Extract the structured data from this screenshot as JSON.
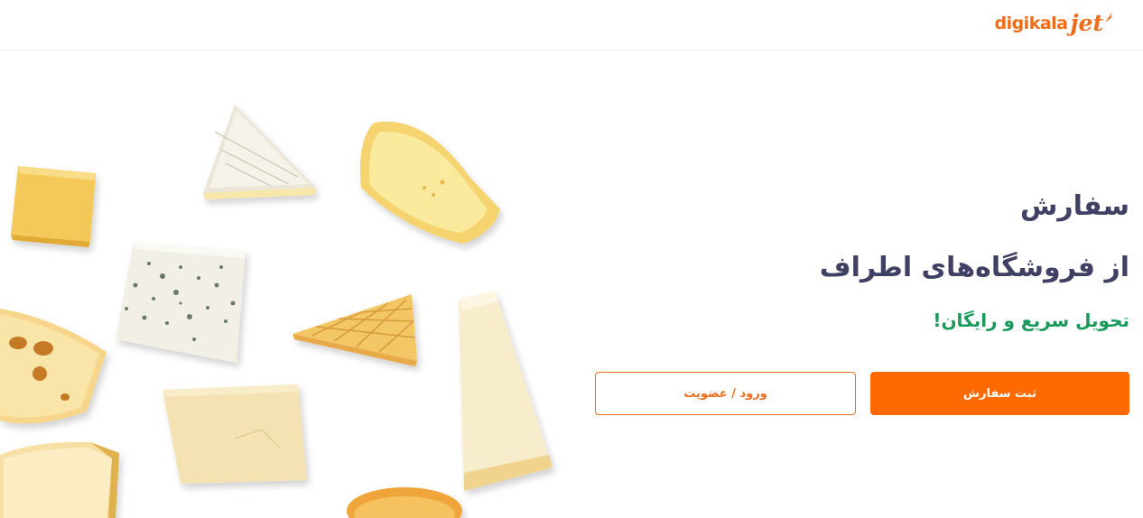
{
  "header": {
    "logo_text": "digikala",
    "logo_suffix": "jet"
  },
  "hero": {
    "title_line_1": "سفارش",
    "title_line_2": "از فروشگاه‌های اطراف",
    "subtitle": "تحویل سریع و رایگان!",
    "image_icon": "cheese-assortment-illustration"
  },
  "actions": {
    "order_label": "ثبت سفارش",
    "login_label": "ورود / عضویت"
  },
  "colors": {
    "brand": "#ef6c1a",
    "primary_button": "#ff6a00",
    "heading": "#3f4064",
    "subtitle": "#1a9a5a"
  }
}
